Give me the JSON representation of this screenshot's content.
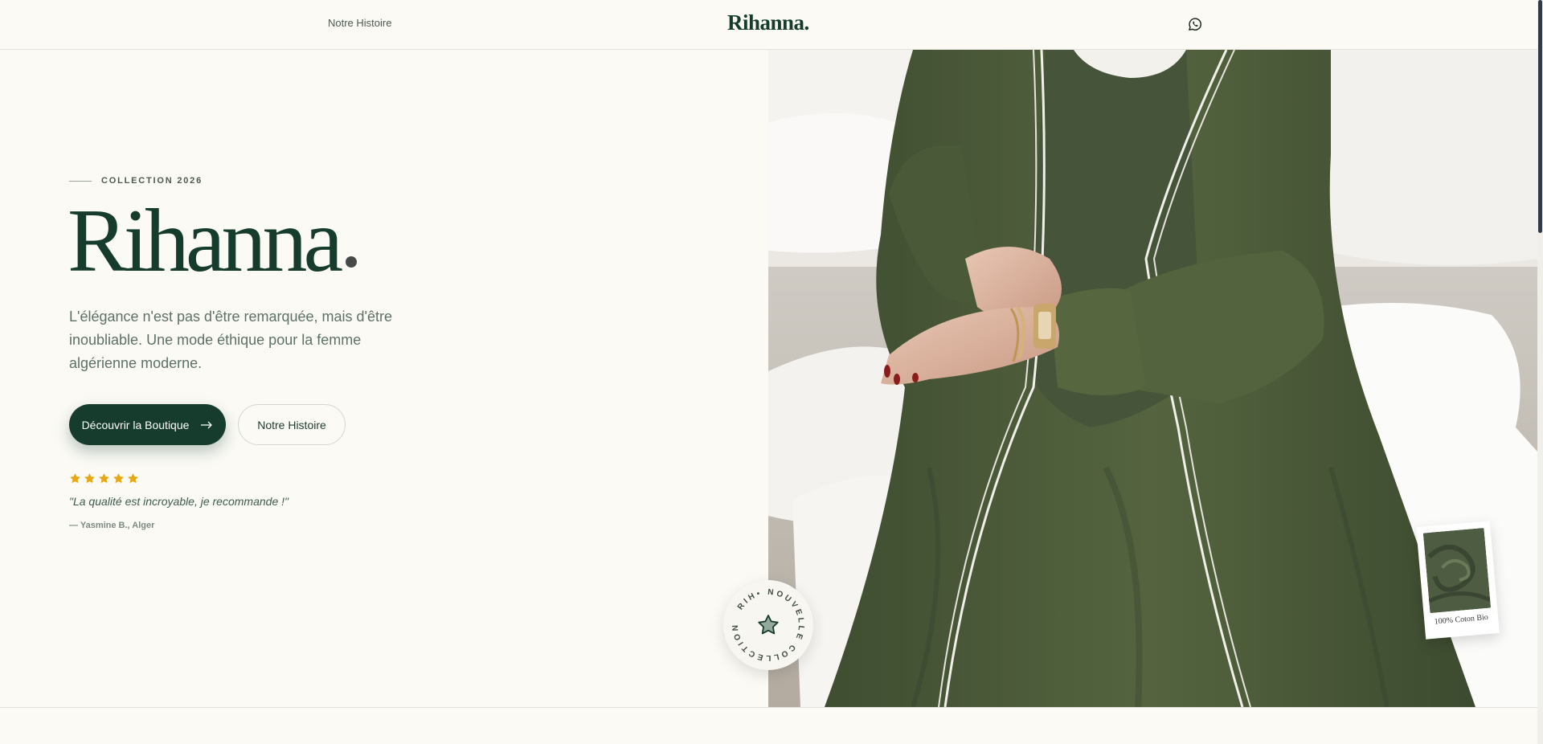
{
  "header": {
    "nav_link": "Notre Histoire",
    "brand": "Rihanna.",
    "whatsapp_icon": "whatsapp-icon"
  },
  "hero": {
    "eyebrow": "COLLECTION 2026",
    "title": "Rihanna",
    "subtitle": "L'élégance n'est pas d'être remarquée, mais d'être inoubliable. Une mode éthique pour la femme algérienne moderne.",
    "primary_button": "Découvrir la Boutique",
    "primary_button_icon": "arrow-right-icon",
    "secondary_button": "Notre Histoire",
    "rating": 5,
    "review_quote": "\"La qualité est incroyable, je recommande !\"",
    "review_author": "— Yasmine B., Alger"
  },
  "badge": {
    "circular_text": "RIH• NOUVELLE COLLECTION",
    "icon": "star-icon"
  },
  "polaroid": {
    "caption": "100% Coton Bio"
  },
  "colors": {
    "brand_green": "#163c2e",
    "background": "#fbfaf5",
    "star": "#e6a817",
    "fabric": "#4f5e3e"
  }
}
